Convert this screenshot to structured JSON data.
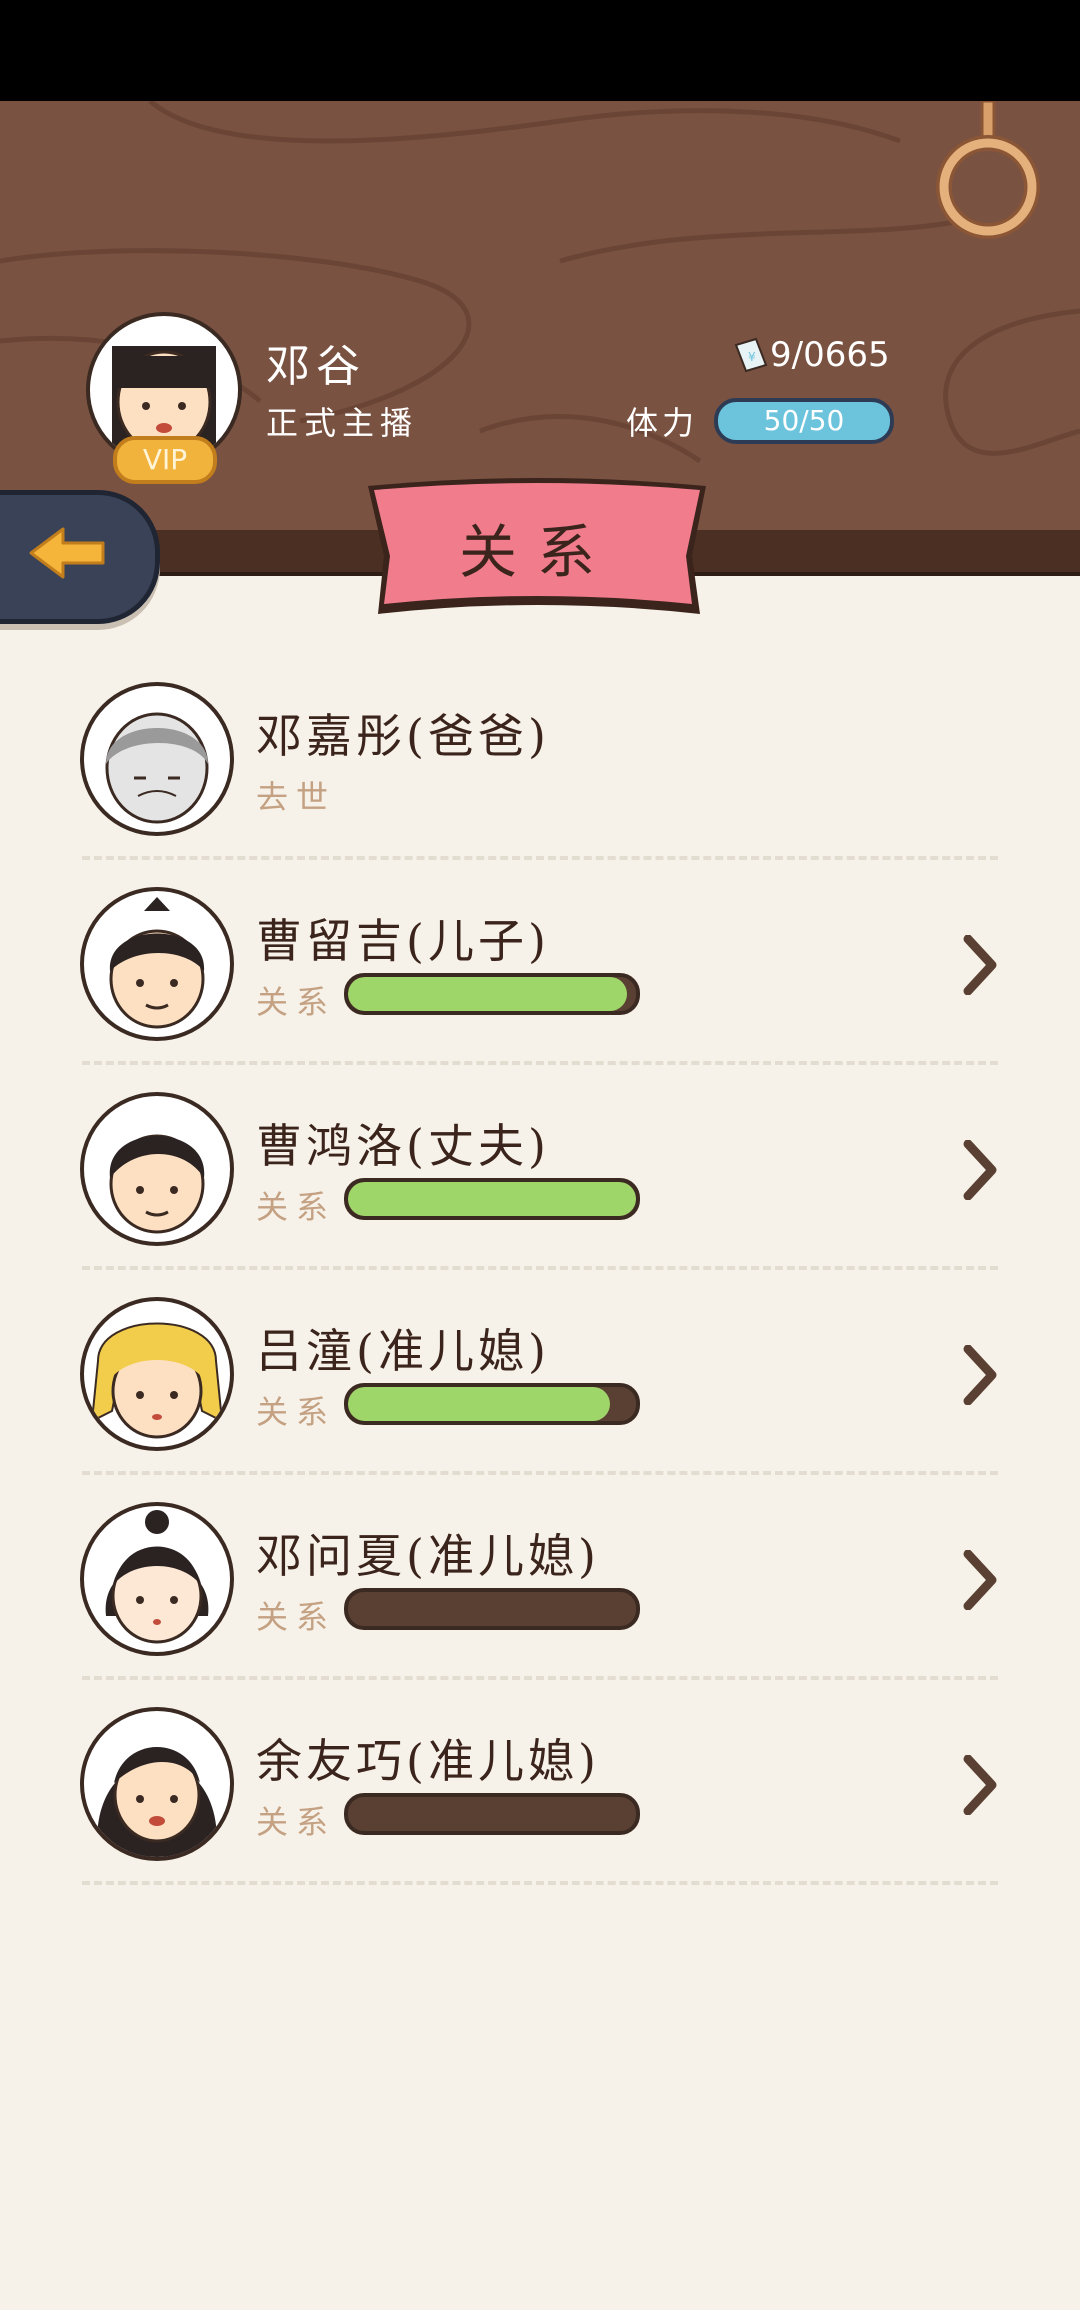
{
  "header": {
    "player_name": "邓谷",
    "player_title": "正式主播",
    "vip_badge": "VIP",
    "money": "9/0665",
    "stamina_label": "体力",
    "stamina_value": "50/50",
    "banner_title": "关系"
  },
  "icons": {
    "back": "arrow-left-icon",
    "money": "banknote-icon",
    "ring": "hanging-ring-icon",
    "row_action": "chevron-right-icon"
  },
  "colors": {
    "header_bg": "#7a5241",
    "banner": "#f07c8c",
    "relation_bar_fill": "#9fd66a",
    "stamina_bar": "#6cc3dc",
    "page_bg": "#f7f2e9"
  },
  "relations": [
    {
      "name": "邓嘉彤(爸爸)",
      "status": "去世",
      "deceased": true
    },
    {
      "name": "曹留吉(儿子)",
      "label": "关系",
      "level": 0.97
    },
    {
      "name": "曹鸿洛(丈夫)",
      "label": "关系",
      "level": 1.0
    },
    {
      "name": "吕潼(准儿媳)",
      "label": "关系",
      "level": 0.91
    },
    {
      "name": "邓问夏(准儿媳)",
      "label": "关系",
      "level": 0.0
    },
    {
      "name": "余友巧(准儿媳)",
      "label": "关系",
      "level": 0.0
    }
  ]
}
